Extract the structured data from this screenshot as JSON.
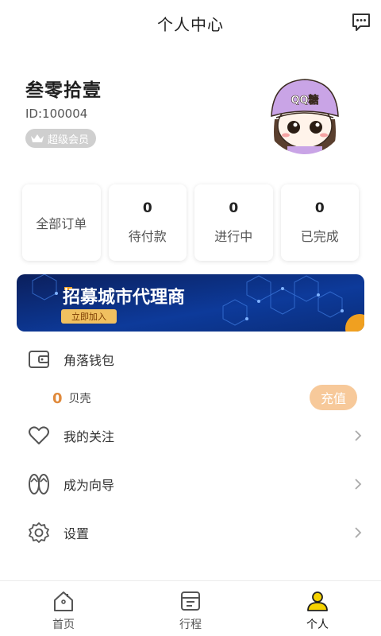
{
  "header": {
    "title": "个人中心"
  },
  "profile": {
    "name": "叁零拾壹",
    "id_text": "ID:100004",
    "vip_label": "超级会员",
    "avatar_hat_text": "QQ糖"
  },
  "orders": [
    {
      "label": "全部订单",
      "count": ""
    },
    {
      "label": "待付款",
      "count": "0"
    },
    {
      "label": "进行中",
      "count": "0"
    },
    {
      "label": "已完成",
      "count": "0"
    }
  ],
  "banner": {
    "title": "招募城市代理商",
    "button": "立即加入"
  },
  "wallet": {
    "label": "角落钱包",
    "balance": "0",
    "unit": "贝壳",
    "recharge_label": "充值"
  },
  "menu": [
    {
      "label": "我的关注",
      "icon": "heart-icon"
    },
    {
      "label": "成为向导",
      "icon": "flip-flops-icon"
    },
    {
      "label": "设置",
      "icon": "gear-icon"
    }
  ],
  "tabs": [
    {
      "label": "首页",
      "icon": "home-icon",
      "active": false
    },
    {
      "label": "行程",
      "icon": "itinerary-icon",
      "active": false
    },
    {
      "label": "个人",
      "icon": "person-icon",
      "active": true
    }
  ],
  "colors": {
    "accent_orange": "#e08a3c",
    "recharge_bg": "#f7c99a",
    "vip_badge": "#cfcfcf",
    "active_tab_yellow": "#f5d200"
  }
}
